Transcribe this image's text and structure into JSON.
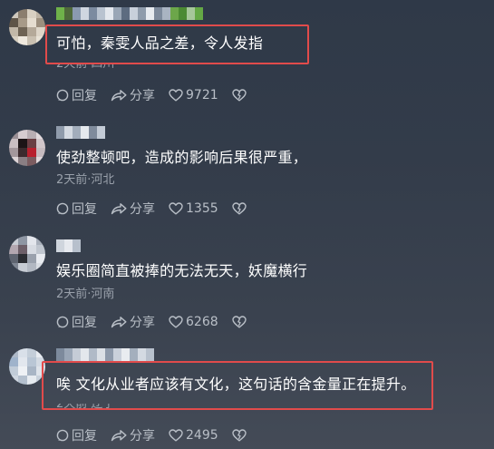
{
  "comments": [
    {
      "text": "可怕，秦雯人品之差，令人发指",
      "meta": "2天前·四川",
      "reply_label": "回复",
      "share_label": "分享",
      "like_count": "9721"
    },
    {
      "text": "使劲整顿吧，造成的影响后果很严重，",
      "meta": "2天前·河北",
      "reply_label": "回复",
      "share_label": "分享",
      "like_count": "1355"
    },
    {
      "text": "娱乐圈简直被捧的无法无天，妖魔横行",
      "meta": "2天前·河南",
      "reply_label": "回复",
      "share_label": "分享",
      "like_count": "6268"
    },
    {
      "text": "唉 文化从业者应该有文化，这句话的含金量正在提升。",
      "meta": "2天前·辽宁",
      "reply_label": "回复",
      "share_label": "分享",
      "like_count": "2495"
    }
  ],
  "colors": {
    "highlight_border": "#e14b4b",
    "meta_text": "#9aa1ab",
    "action_text": "#b9bfc7"
  },
  "icons": [
    "reply-icon",
    "share-icon",
    "like-icon",
    "dislike-icon"
  ]
}
